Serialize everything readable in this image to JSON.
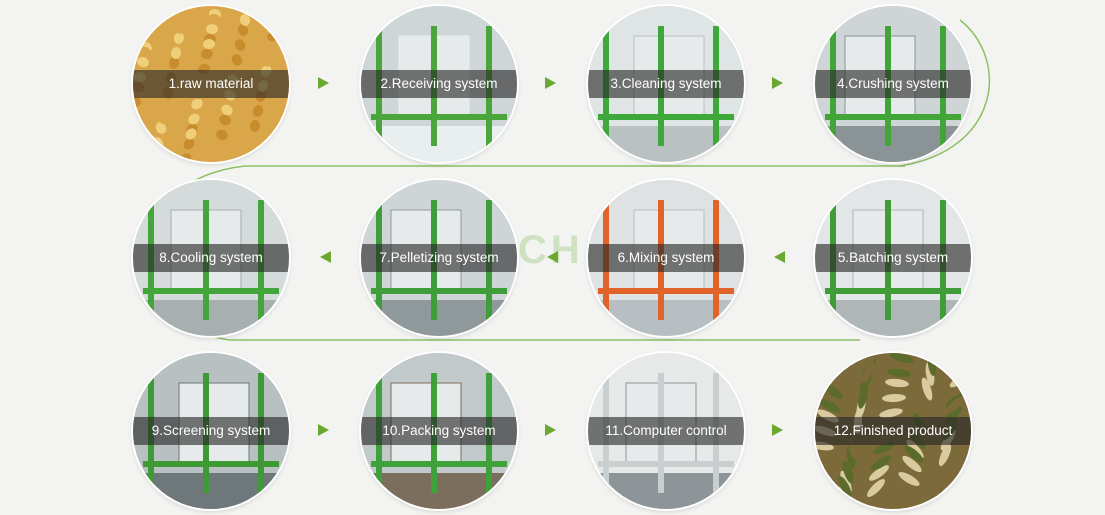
{
  "steps": [
    {
      "label": "1.raw material",
      "image": "corn kernels",
      "palette": [
        "#d9a64a",
        "#c98c2c",
        "#f0cf7a"
      ]
    },
    {
      "label": "2.Receiving system",
      "image": "receiving hopper room",
      "palette": [
        "#cfd6d8",
        "#4aa63a",
        "#e9eeee"
      ]
    },
    {
      "label": "3.Cleaning system",
      "image": "drum cleaner",
      "palette": [
        "#dfe4e4",
        "#3fa83a",
        "#b9c1c3"
      ]
    },
    {
      "label": "4.Crushing system",
      "image": "hammer mill",
      "palette": [
        "#cfd5d6",
        "#42a538",
        "#8a9496"
      ]
    },
    {
      "label": "5.Batching system",
      "image": "batching bins",
      "palette": [
        "#e2e6e6",
        "#3f9c36",
        "#aeb6b8"
      ]
    },
    {
      "label": "6.Mixing system",
      "image": "mixer",
      "palette": [
        "#dfe2e3",
        "#e0632a",
        "#b7bfc2"
      ]
    },
    {
      "label": "7.Pelletizing system",
      "image": "pellet mill",
      "palette": [
        "#cfd5d7",
        "#3e9e39",
        "#8f999b"
      ]
    },
    {
      "label": "8.Cooling system",
      "image": "counterflow cooler",
      "palette": [
        "#d5dadb",
        "#43a63a",
        "#a7afb1"
      ]
    },
    {
      "label": "9.Screening system",
      "image": "screening machine",
      "palette": [
        "#b9c0c2",
        "#3e9a34",
        "#6e7779"
      ]
    },
    {
      "label": "10.Packing system",
      "image": "packing scale platform",
      "palette": [
        "#c2c9cb",
        "#3ea23a",
        "#7b6e5d"
      ]
    },
    {
      "label": "11.Computer control",
      "image": "control room cabinets",
      "palette": [
        "#e7e9e9",
        "#c9cfd1",
        "#8d9599"
      ]
    },
    {
      "label": "12.Finished product",
      "image": "feed pellets",
      "palette": [
        "#7c6a3a",
        "#d9caa0",
        "#5a6b2a"
      ]
    }
  ],
  "watermark": "RICH",
  "colors": {
    "accent": "#6aa82f",
    "background": "#f3f4f2",
    "label_band": "#262626"
  }
}
